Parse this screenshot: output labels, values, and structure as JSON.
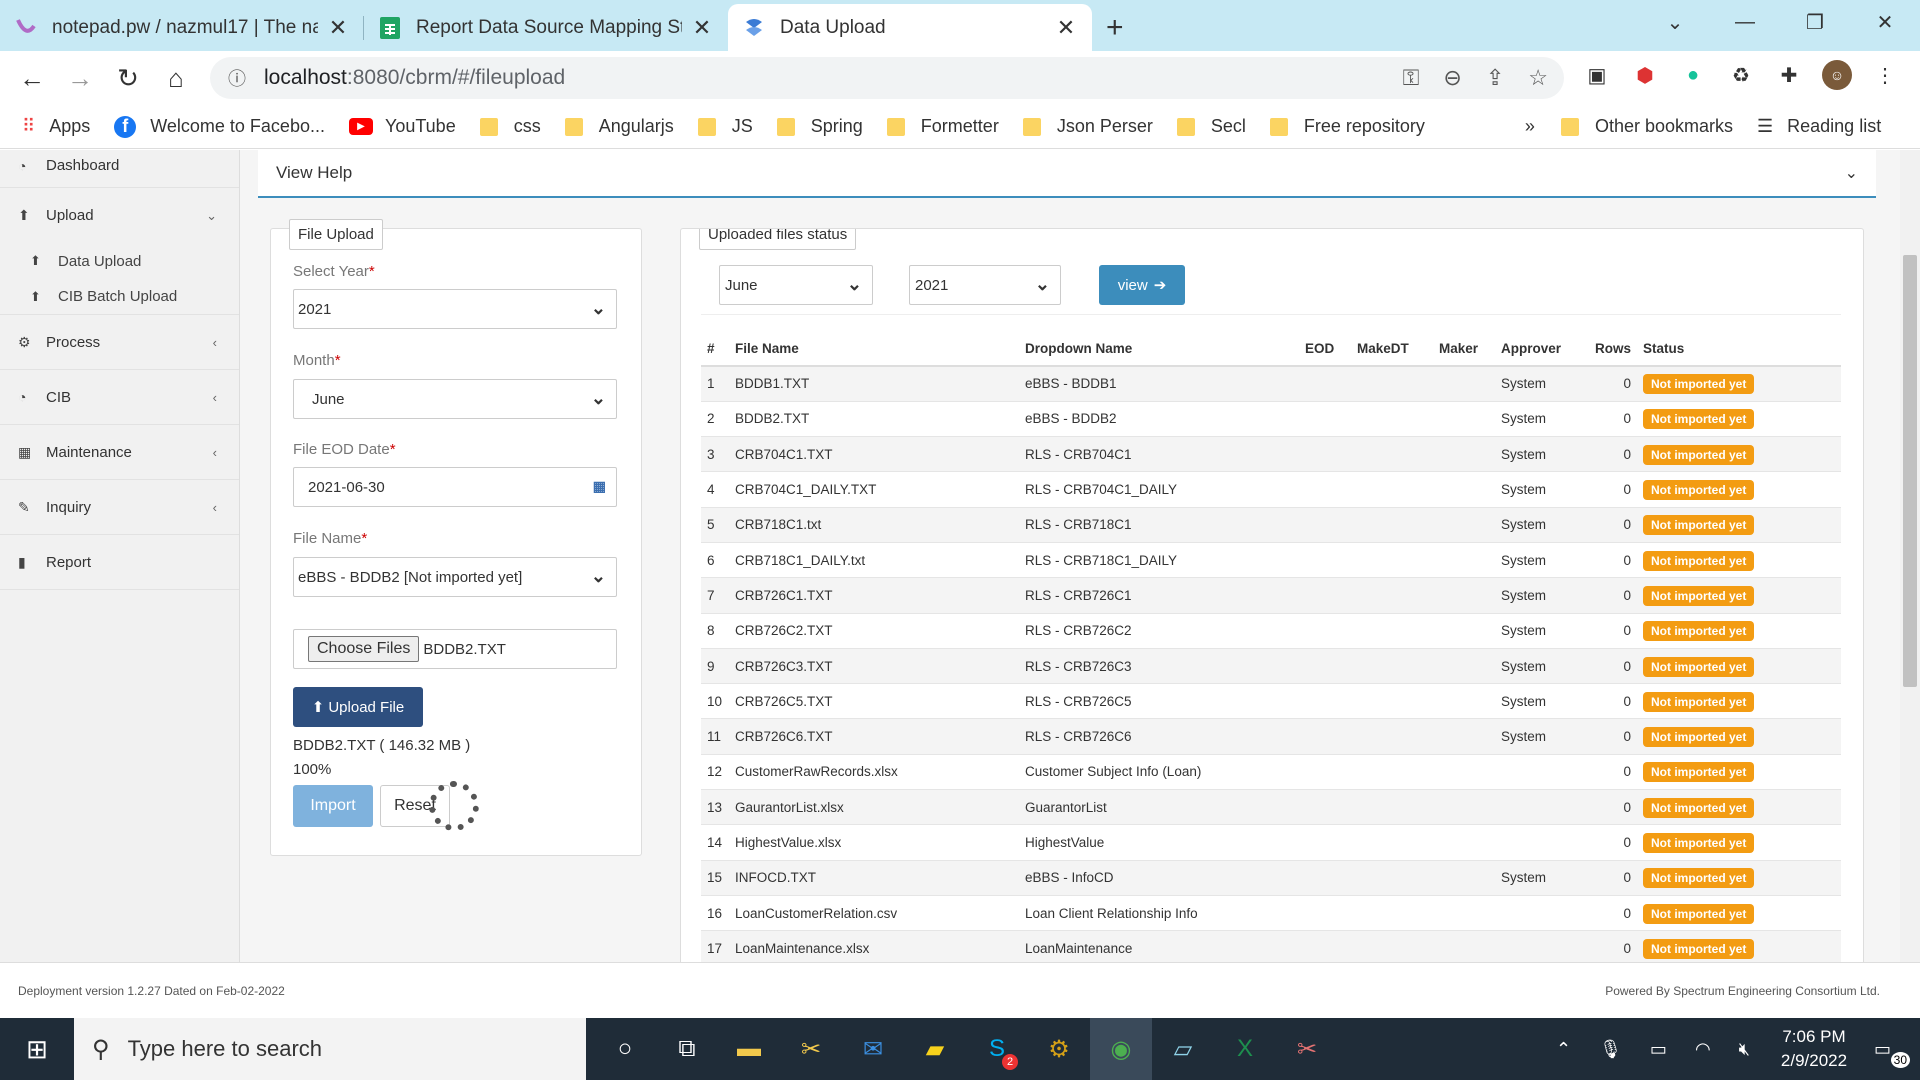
{
  "browser": {
    "tabs": [
      {
        "title": "notepad.pw / nazmul17 | The nap",
        "active": false
      },
      {
        "title": "Report Data Source Mapping Sta",
        "active": false
      },
      {
        "title": "Data Upload",
        "active": true
      }
    ],
    "url_host": "localhost",
    "url_path": ":8080/cbrm/#/fileupload",
    "bookmarks": [
      "Apps",
      "Welcome to Facebo...",
      "YouTube",
      "css",
      "Angularjs",
      "JS",
      "Spring",
      "Formetter",
      "Json Perser",
      "Secl",
      "Free repository"
    ],
    "more": "»",
    "other_bookmarks": "Other bookmarks",
    "reading_list": "Reading list"
  },
  "sidebar": {
    "dashboard": "Dashboard",
    "upload": "Upload",
    "data_upload": "Data Upload",
    "cib_batch": "CIB Batch Upload",
    "process": "Process",
    "cib": "CIB",
    "maintenance": "Maintenance",
    "inquiry": "Inquiry",
    "report": "Report"
  },
  "help": {
    "label": "View Help"
  },
  "upload_form": {
    "legend": "File Upload",
    "year_label": "Select Year",
    "year_value": "2021",
    "month_label": "Month",
    "month_value": "June",
    "eod_label": "File EOD Date",
    "eod_value": "2021-06-30",
    "file_name_label": "File Name",
    "file_name_value": "eBBS - BDDB2 [Not imported yet]",
    "choose_files": "Choose Files",
    "chosen_file": "BDDB2.TXT",
    "upload_button": "Upload File",
    "file_info": "BDDB2.TXT ( 146.32 MB )",
    "progress": "100%",
    "import_button": "Import",
    "reset_button": "Reset"
  },
  "status_panel": {
    "legend": "Uploaded files status",
    "month_value": "June",
    "year_value": "2021",
    "view_button": "view",
    "headers": [
      "#",
      "File Name",
      "Dropdown Name",
      "EOD",
      "MakeDT",
      "Maker",
      "Approver",
      "Rows",
      "Status"
    ],
    "rows": [
      {
        "n": "1",
        "file": "BDDB1.TXT",
        "dd": "eBBS - BDDB1",
        "eod": "",
        "makedt": "",
        "maker": "",
        "approver": "System",
        "rows": "0",
        "status": "Not imported yet"
      },
      {
        "n": "2",
        "file": "BDDB2.TXT",
        "dd": "eBBS - BDDB2",
        "eod": "",
        "makedt": "",
        "maker": "",
        "approver": "System",
        "rows": "0",
        "status": "Not imported yet"
      },
      {
        "n": "3",
        "file": "CRB704C1.TXT",
        "dd": "RLS - CRB704C1",
        "eod": "",
        "makedt": "",
        "maker": "",
        "approver": "System",
        "rows": "0",
        "status": "Not imported yet"
      },
      {
        "n": "4",
        "file": "CRB704C1_DAILY.TXT",
        "dd": "RLS - CRB704C1_DAILY",
        "eod": "",
        "makedt": "",
        "maker": "",
        "approver": "System",
        "rows": "0",
        "status": "Not imported yet"
      },
      {
        "n": "5",
        "file": "CRB718C1.txt",
        "dd": "RLS - CRB718C1",
        "eod": "",
        "makedt": "",
        "maker": "",
        "approver": "System",
        "rows": "0",
        "status": "Not imported yet"
      },
      {
        "n": "6",
        "file": "CRB718C1_DAILY.txt",
        "dd": "RLS - CRB718C1_DAILY",
        "eod": "",
        "makedt": "",
        "maker": "",
        "approver": "System",
        "rows": "0",
        "status": "Not imported yet"
      },
      {
        "n": "7",
        "file": "CRB726C1.TXT",
        "dd": "RLS - CRB726C1",
        "eod": "",
        "makedt": "",
        "maker": "",
        "approver": "System",
        "rows": "0",
        "status": "Not imported yet"
      },
      {
        "n": "8",
        "file": "CRB726C2.TXT",
        "dd": "RLS - CRB726C2",
        "eod": "",
        "makedt": "",
        "maker": "",
        "approver": "System",
        "rows": "0",
        "status": "Not imported yet"
      },
      {
        "n": "9",
        "file": "CRB726C3.TXT",
        "dd": "RLS - CRB726C3",
        "eod": "",
        "makedt": "",
        "maker": "",
        "approver": "System",
        "rows": "0",
        "status": "Not imported yet"
      },
      {
        "n": "10",
        "file": "CRB726C5.TXT",
        "dd": "RLS - CRB726C5",
        "eod": "",
        "makedt": "",
        "maker": "",
        "approver": "System",
        "rows": "0",
        "status": "Not imported yet"
      },
      {
        "n": "11",
        "file": "CRB726C6.TXT",
        "dd": "RLS - CRB726C6",
        "eod": "",
        "makedt": "",
        "maker": "",
        "approver": "System",
        "rows": "0",
        "status": "Not imported yet"
      },
      {
        "n": "12",
        "file": "CustomerRawRecords.xlsx",
        "dd": "Customer Subject Info (Loan)",
        "eod": "",
        "makedt": "",
        "maker": "",
        "approver": "",
        "rows": "0",
        "status": "Not imported yet"
      },
      {
        "n": "13",
        "file": "GaurantorList.xlsx",
        "dd": "GuarantorList",
        "eod": "",
        "makedt": "",
        "maker": "",
        "approver": "",
        "rows": "0",
        "status": "Not imported yet"
      },
      {
        "n": "14",
        "file": "HighestValue.xlsx",
        "dd": "HighestValue",
        "eod": "",
        "makedt": "",
        "maker": "",
        "approver": "",
        "rows": "0",
        "status": "Not imported yet"
      },
      {
        "n": "15",
        "file": "INFOCD.TXT",
        "dd": "eBBS - InfoCD",
        "eod": "",
        "makedt": "",
        "maker": "",
        "approver": "System",
        "rows": "0",
        "status": "Not imported yet"
      },
      {
        "n": "16",
        "file": "LoanCustomerRelation.csv",
        "dd": "Loan Client Relationship Info",
        "eod": "",
        "makedt": "",
        "maker": "",
        "approver": "",
        "rows": "0",
        "status": "Not imported yet"
      },
      {
        "n": "17",
        "file": "LoanMaintenance.xlsx",
        "dd": "LoanMaintenance",
        "eod": "",
        "makedt": "",
        "maker": "",
        "approver": "",
        "rows": "0",
        "status": "Not imported yet"
      }
    ]
  },
  "footer": {
    "left": "Deployment version 1.2.27 Dated on Feb-02-2022",
    "right": "Powered By Spectrum Engineering Consortium Ltd."
  },
  "taskbar": {
    "search_placeholder": "Type here to search",
    "time": "7:06 PM",
    "date": "2/9/2022",
    "notif_count": "30",
    "skype_badge": "2"
  },
  "colors": {
    "accent": "#3c8dbc",
    "badge": "#f39c12",
    "primary_btn": "#2e4f7f",
    "import_btn": "#7fb2dd"
  }
}
